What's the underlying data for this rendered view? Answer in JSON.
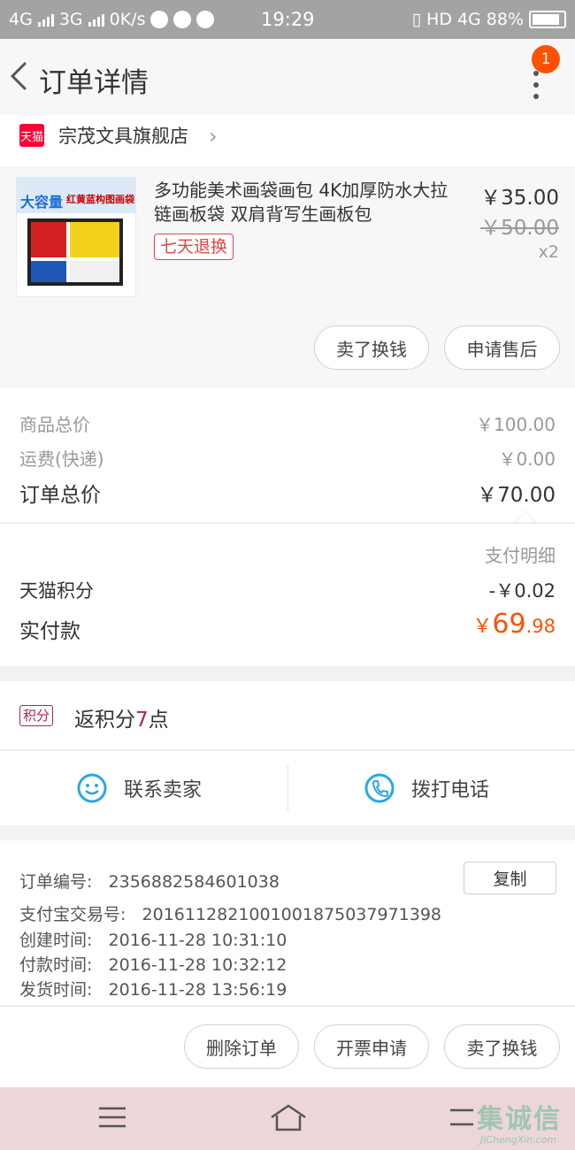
{
  "status_bar": {
    "network1": "4G",
    "network2": "3G",
    "speed": "0K/s",
    "time": "19:29",
    "hd": "HD",
    "network3": "4G",
    "battery": "88%"
  },
  "header": {
    "title": "订单详情",
    "badge_count": "1"
  },
  "shop": {
    "logo_text": "天猫",
    "name": "宗茂文具旗舰店"
  },
  "product": {
    "thumb_brand": "大容量",
    "thumb_sub": "红黄蓝构图画袋",
    "title": "多功能美术画袋画包 4K加厚防水大拉链画板袋 双肩背写生画板包",
    "return_tag": "七天退换",
    "price": "￥35.00",
    "original_price": "￥50.00",
    "quantity": "x2",
    "sell_button": "卖了换钱",
    "aftersale_button": "申请售后"
  },
  "totals": {
    "goods_total_label": "商品总价",
    "goods_total_value": "￥100.00",
    "shipping_label": "运费(快递)",
    "shipping_value": "￥0.00",
    "order_total_label": "订单总价",
    "order_total_value": "￥70.00"
  },
  "payment": {
    "detail_label": "支付明细",
    "points_label": "天猫积分",
    "points_value": "-￥0.02",
    "paid_label": "实付款",
    "paid_currency": "￥",
    "paid_int": "69",
    "paid_dec": ".98"
  },
  "rewards": {
    "tag": "积分",
    "text_prefix": "返积分",
    "number": "7",
    "text_suffix": "点"
  },
  "contact": {
    "seller_label": "联系卖家",
    "phone_label": "拨打电话"
  },
  "order_info": {
    "order_no_label": "订单编号:",
    "order_no": "2356882584601038",
    "copy_button": "复制",
    "alipay_label": "支付宝交易号:",
    "alipay_no": "2016112821001001875037971398",
    "created_label": "创建时间:",
    "created": "2016-11-28 10:31:10",
    "paid_label": "付款时间:",
    "paid": "2016-11-28 10:32:12",
    "shipped_label": "发货时间:",
    "shipped": "2016-11-28 13:56:19"
  },
  "actions": {
    "delete": "删除订单",
    "invoice": "开票申请",
    "sell": "卖了换钱"
  },
  "watermark": {
    "main": "集诚信",
    "sub": "JiChengXin.com"
  },
  "colors": {
    "accent": "#ff5000",
    "tmall_red": "#ff0036",
    "points_red": "#b0234a",
    "link_blue": "#2aa7e0"
  }
}
